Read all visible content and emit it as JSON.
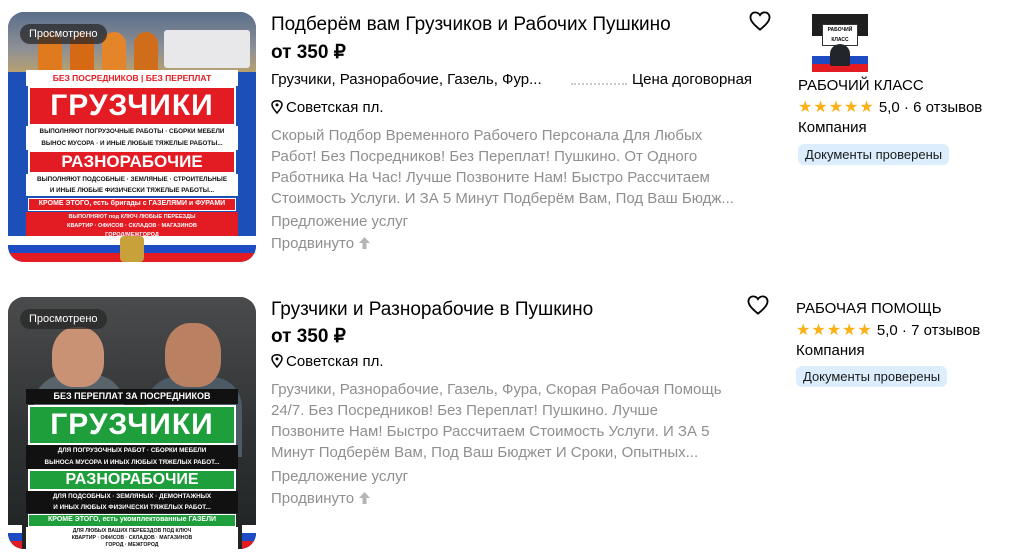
{
  "listings": [
    {
      "viewed_label": "Просмотрено",
      "title": "Подберём вам Грузчиков и Рабочих Пушкино",
      "price": "от 350 ₽",
      "tags": "Грузчики, Разнорабочие, Газель, Фур...",
      "deal": "Цена договорная",
      "address": "Советская пл.",
      "description_lines": [
        "Скорый Подбор Временного Рабочего Персонала Для Любых",
        "Работ! Без Посредников! Без Переплат! Пушкино. От Одного",
        "Работника На Час! Лучше Позвоните Нам! Быстро Рассчитаем",
        "Стоимость Услуги. И ЗА 5 Минут Подберём Вам, Под Ваш Бюдж..."
      ],
      "category": "Предложение услуг",
      "promoted": "Продвинуто",
      "poster": {
        "line1": "БЕЗ ПОСРЕДНИКОВ | БЕЗ ПЕРЕПЛАТ",
        "heading1": "ГРУЗЧИКИ",
        "sub1": "ВЫПОЛНЯЮТ ПОГРУЗОЧНЫЕ РАБОТЫ · СБОРКИ МЕБЕЛИ",
        "sub2": "ВЫНОС МУСОРА · И ИНЫЕ ЛЮБЫЕ ТЯЖЕЛЫЕ РАБОТЫ...",
        "heading2": "РАЗНОРАБОЧИЕ",
        "sub3": "ВЫПОЛНЯЮТ ПОДСОБНЫЕ · ЗЕМЛЯНЫЕ · СТРОИТЕЛЬНЫЕ",
        "sub4": "И ИНЫЕ ЛЮБЫЕ ФИЗИЧЕСКИ ТЯЖЕЛЫЕ РАБОТЫ...",
        "extra": "КРОМЕ ЭТОГО, есть бригады с ГАЗЕЛЯМИ и ФУРАМИ",
        "foot1": "ВЫПОЛНЯЮТ под КЛЮЧ ЛЮБЫЕ ПЕРЕЕЗДЫ",
        "foot2": "КВАРТИР · ОФИСОВ · СКЛАДОВ · МАГАЗИНОВ",
        "foot3": "ГОРОД/МЕЖГОРОД"
      },
      "seller": {
        "logo_text": "РАБОЧИЙ КЛАСС",
        "name": "РАБОЧИЙ КЛАСС",
        "stars": "★★★★★",
        "score": "5,0",
        "reviews": "6 отзывов",
        "type": "Компания",
        "badge": "Документы проверены"
      }
    },
    {
      "viewed_label": "Просмотрено",
      "title": "Грузчики и Разнорабочие в Пушкино",
      "price": "от 350 ₽",
      "address": "Советская пл.",
      "description_lines": [
        "Грузчики, Разнорабочие, Газель, Фура, Скорая Рабочая Помощь",
        "24/7. Без Посредников! Без Переплат! Пушкино. Лучше",
        "Позвоните Нам! Быстро Рассчитаем Стоимость Услуги. И ЗА 5",
        "Минут Подберём Вам, Под Ваш Бюджет И Сроки, Опытных..."
      ],
      "category": "Предложение услуг",
      "promoted": "Продвинуто",
      "poster": {
        "line1": "БЕЗ ПЕРЕПЛАТ ЗА ПОСРЕДНИКОВ",
        "heading1": "ГРУЗЧИКИ",
        "sub1": "ДЛЯ ПОГРУЗОЧНЫХ РАБОТ · СБОРКИ МЕБЕЛИ",
        "sub2": "ВЫНОСА МУСОРА И ИНЫХ ЛЮБЫХ ТЯЖЕЛЫХ РАБОТ...",
        "heading2": "РАЗНОРАБОЧИЕ",
        "sub3": "ДЛЯ ПОДСОБНЫХ · ЗЕМЛЯНЫХ · ДЕМОНТАЖНЫХ",
        "sub4": "И ИНЫХ ЛЮБЫХ ФИЗИЧЕСКИ ТЯЖЕЛЫХ РАБОТ...",
        "extra": "КРОМЕ ЭТОГО, есть укомплектованные ГАЗЕЛИ",
        "foot1": "ДЛЯ ЛЮБЫХ ВАШИХ ПЕРЕЕЗДОВ ПОД КЛЮЧ",
        "foot2": "КВАРТИР · ОФИСОВ · СКЛАДОВ · МАГАЗИНОВ",
        "foot3": "ГОРОД · МЕЖГОРОД"
      },
      "seller": {
        "name": "РАБОЧАЯ ПОМОЩЬ",
        "stars": "★★★★★",
        "score": "5,0",
        "reviews": "7 отзывов",
        "type": "Компания",
        "badge": "Документы проверены"
      }
    }
  ],
  "colors": {
    "star": "#fbb016",
    "badge_bg": "#dceefe",
    "muted_text": "#8f8f8f",
    "poster1_bg": "#1d4fb8",
    "poster_red": "#e31b23",
    "poster_green": "#1f9e3c"
  },
  "icons": [
    "heart-icon",
    "location-pin-icon",
    "arrow-up-icon",
    "star-icon"
  ]
}
